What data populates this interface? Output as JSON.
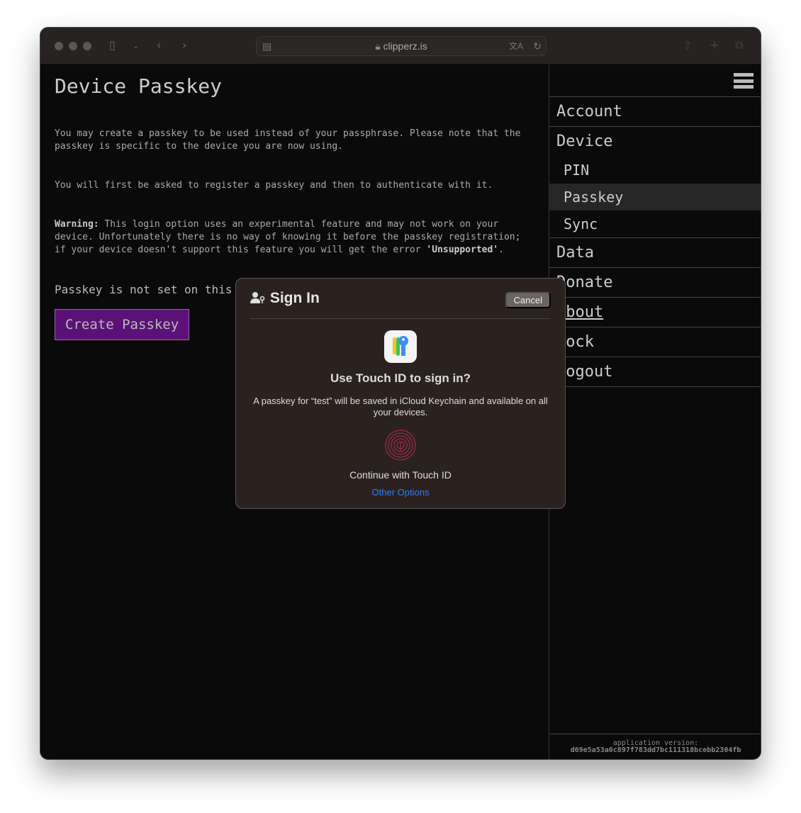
{
  "browser": {
    "url": "clipperz.is",
    "icons": [
      "sidebar-icon",
      "chevron-down-icon",
      "back-icon",
      "forward-icon",
      "page-menu-icon",
      "lock-icon",
      "translate-icon",
      "reload-icon",
      "share-icon",
      "new-tab-icon",
      "tabs-icon"
    ]
  },
  "main": {
    "title": "Device Passkey",
    "p1": "You may create a passkey to be used instead of your passphrase. Please note that the passkey is specific to the device you are now using.",
    "p2": "You will first be asked to register a passkey and then to authenticate with it.",
    "p3_bold": "Warning:",
    "p3": " This login option uses an experimental feature and may not work on your device. Unfortunately there is no way of knowing it before the passkey registration; if your device doesn't support this feature you will get the error ",
    "p3_err": "'Unsupported'",
    "p3_end": ".",
    "status": "Passkey is not set on this device.",
    "create_label": "Create Passkey",
    "accent": "#5c1178"
  },
  "sidebar": {
    "account": "Account",
    "device": "Device",
    "pin": "PIN",
    "passkey": "Passkey",
    "sync": "Sync",
    "data": "Data",
    "donate": "Donate",
    "about": "About",
    "lock": "Lock",
    "logout": "Logout",
    "version_label": "application version:",
    "version": "d69e5a53a0c897f783dd7bc111318bcebb2304fb"
  },
  "dialog": {
    "title": "Sign In",
    "cancel": "Cancel",
    "question": "Use Touch ID to sign in?",
    "description": "A passkey for “test” will be saved in iCloud Keychain and available on all your devices.",
    "continue": "Continue with Touch ID",
    "other": "Other Options",
    "link_color": "#2f7cf6"
  }
}
